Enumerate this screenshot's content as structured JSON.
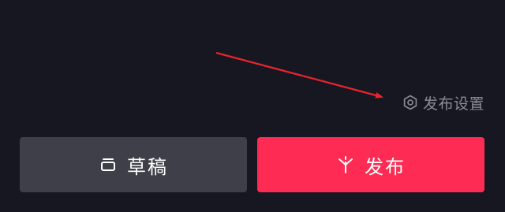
{
  "publish_settings": {
    "label": "发布设置",
    "icon": "hexagon-settings-icon"
  },
  "actions": {
    "draft": {
      "label": "草稿",
      "icon": "draft-box-icon"
    },
    "publish": {
      "label": "发布",
      "icon": "sparkle-icon"
    }
  },
  "colors": {
    "background": "#171722",
    "draft_button": "#3f3f49",
    "publish_button": "#fe2c55",
    "annotation_arrow": "#e8242c",
    "settings_text": "#8b8b93"
  }
}
